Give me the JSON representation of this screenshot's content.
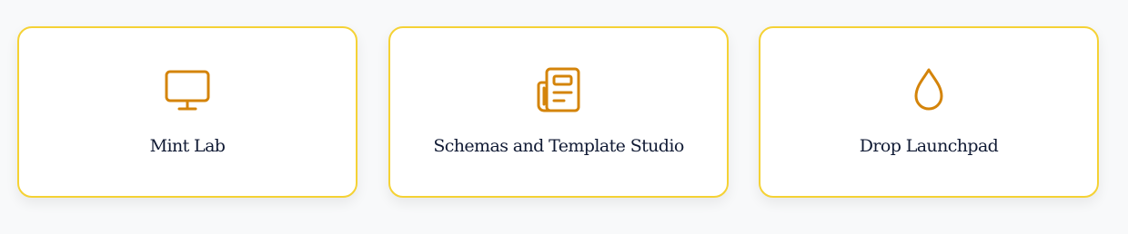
{
  "colors": {
    "accent_border": "#f5d235",
    "icon": "#d4840a",
    "label_text": "#101a34",
    "card_background": "#ffffff",
    "page_background": "#f8f9fa"
  },
  "cards": [
    {
      "label": "Mint Lab",
      "icon": "monitor-icon"
    },
    {
      "label": "Schemas and Template Studio",
      "icon": "newspaper-icon"
    },
    {
      "label": "Drop Launchpad",
      "icon": "droplet-icon"
    }
  ]
}
